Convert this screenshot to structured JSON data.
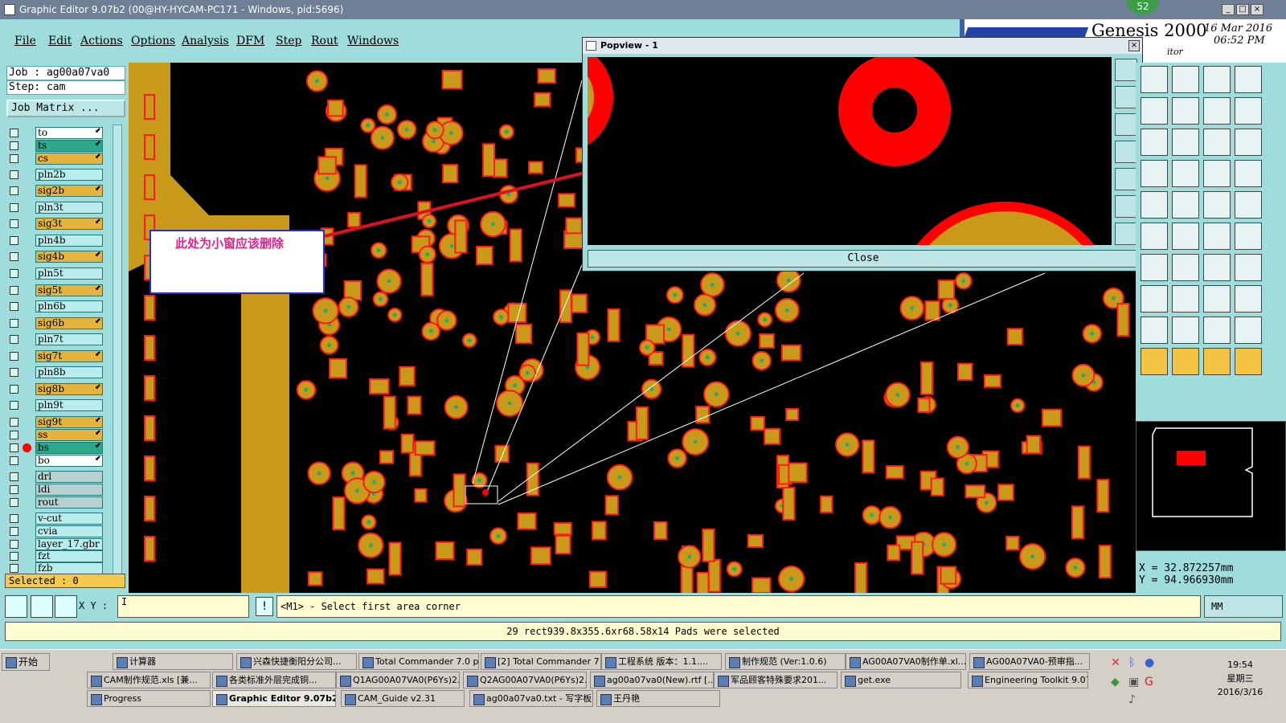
{
  "window": {
    "title": "Graphic Editor 9.07b2 (00@HY-HYCAM-PC171 - Windows, pid:5696)"
  },
  "menu": [
    "File",
    "Edit",
    "Actions",
    "Options",
    "Analysis",
    "DFM",
    "Step",
    "Rout",
    "Windows"
  ],
  "brand": {
    "product": "Genesis 2000",
    "date": "16 Mar 2016",
    "time": "06:52 PM",
    "subtitle": "itor"
  },
  "badge": "52",
  "job": {
    "job_line": "Job : ag00a07va0",
    "step_line": "Step: cam",
    "matrix_label": "Job Matrix ..."
  },
  "layers": [
    {
      "name": "to",
      "color": "#ffffff",
      "mark": "⬋"
    },
    {
      "name": "ts",
      "color": "#2aa88a",
      "mark": "⬋"
    },
    {
      "name": "cs",
      "color": "#e6b33c",
      "mark": "⬋"
    },
    {
      "name": "pln2b",
      "color": "#b9ecec",
      "mark": ""
    },
    {
      "name": "sig2b",
      "color": "#e6b33c",
      "mark": "⬋"
    },
    {
      "name": "pln3t",
      "color": "#b9ecec",
      "mark": ""
    },
    {
      "name": "sig3t",
      "color": "#e6b33c",
      "mark": "⬋"
    },
    {
      "name": "pln4b",
      "color": "#b9ecec",
      "mark": ""
    },
    {
      "name": "sig4b",
      "color": "#e6b33c",
      "mark": "⬋"
    },
    {
      "name": "pln5t",
      "color": "#b9ecec",
      "mark": ""
    },
    {
      "name": "sig5t",
      "color": "#e6b33c",
      "mark": "⬋"
    },
    {
      "name": "pln6b",
      "color": "#b9ecec",
      "mark": ""
    },
    {
      "name": "sig6b",
      "color": "#e6b33c",
      "mark": "⬋"
    },
    {
      "name": "pln7t",
      "color": "#b9ecec",
      "mark": ""
    },
    {
      "name": "sig7t",
      "color": "#e6b33c",
      "mark": "⬋"
    },
    {
      "name": "pln8b",
      "color": "#b9ecec",
      "mark": ""
    },
    {
      "name": "sig8b",
      "color": "#e6b33c",
      "mark": "⬋"
    },
    {
      "name": "pln9t",
      "color": "#b9ecec",
      "mark": ""
    },
    {
      "name": "sig9t",
      "color": "#e6b33c",
      "mark": "⬋"
    },
    {
      "name": "ss",
      "color": "#e6b33c",
      "mark": "⬋"
    },
    {
      "name": "bs",
      "color": "#2aa88a",
      "mark": "⬋"
    },
    {
      "name": "bo",
      "color": "#ffffff",
      "mark": "⬋"
    },
    {
      "name": "drl",
      "color": "#b9d0d0",
      "mark": ""
    },
    {
      "name": "ldi",
      "color": "#b9d0d0",
      "mark": ""
    },
    {
      "name": "rout",
      "color": "#b9d0d0",
      "mark": ""
    },
    {
      "name": "v-cut",
      "color": "#b9ecec",
      "mark": ""
    },
    {
      "name": "cvia",
      "color": "#b9ecec",
      "mark": ""
    },
    {
      "name": "layer_17.gbr",
      "color": "#b9ecec",
      "mark": ""
    },
    {
      "name": "fzt",
      "color": "#b9ecec",
      "mark": ""
    },
    {
      "name": "fzb",
      "color": "#b9ecec",
      "mark": ""
    }
  ],
  "selected": "Selected : 0",
  "annotation": "此处为小窗应该删除",
  "popview": {
    "title": "Popview - 1",
    "close_label": "Close"
  },
  "coords": {
    "x": "X = 32.872257mm",
    "y": "Y = 94.966930mm"
  },
  "command": {
    "xy_label": "X Y :",
    "xy_value": "I",
    "info_glyph": "!",
    "prompt": "<M1> - Select first area corner",
    "units": "MM"
  },
  "status": "29 rect939.8x355.6xr68.58x14 Pads were selected",
  "taskbar": {
    "start": "开始",
    "clock": [
      "19:54",
      "星期三",
      "2016/3/16"
    ],
    "tasks": [
      "计算器",
      "兴森快捷衡阳分公司...",
      "Total Commander 7.0 p...",
      "[2] Total Commander 7....",
      "工程系统  版本：1.1....",
      "制作规范 (Ver:1.0.6)",
      "AG00A07VA0制作单.xl...",
      "AG00A07VA0-预审指...",
      "CAM制作规范.xls [兼...",
      "各类标准外层完成铜...",
      "Q1AG00A07VA0(P6Ys)2...",
      "Q2AG00A07VA0(P6Ys)2...",
      "ag00a07va0(New).rtf [...",
      "军品顾客特殊要求201...",
      "get.exe",
      "Engineering Toolkit 9.07...",
      "Progress",
      "Graphic Editor 9.07b2 ...",
      "CAM_Guide v2.31",
      "ag00a07va0.txt - 写字板",
      "王丹艳"
    ]
  },
  "colors": {
    "pad": "#c99a1a",
    "pad_outline": "#ff1a1a",
    "highlight": "#ff0000",
    "panel": "#9fdcdc"
  }
}
